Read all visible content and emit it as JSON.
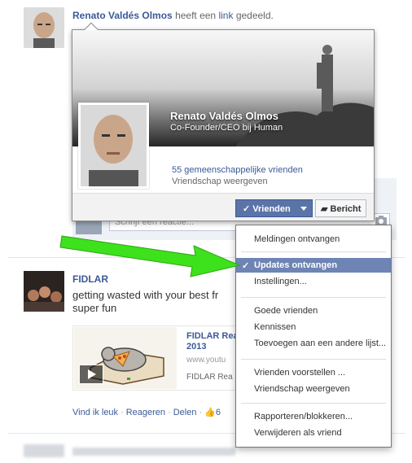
{
  "post1": {
    "author": "Renato Valdés Olmos",
    "verb": "heeft een",
    "link_word": "link",
    "verb_end": "gedeeld."
  },
  "hovercard": {
    "name": "Renato Valdés Olmos",
    "job": "Co-Founder/CEO bij Human",
    "mutual_friends": "55 gemeenschappelijke vrienden",
    "view_friendship": "Vriendschap weergeven",
    "friends_button": "Vrienden",
    "message_button": "Bericht"
  },
  "comment": {
    "placeholder": "Schrijf een reactie..."
  },
  "post2": {
    "author": "FIDLAR",
    "text": "getting wasted with your best fr... super fun",
    "text_line1": "getting wasted with your best fr",
    "text_line2": "super fun",
    "attachment": {
      "title_line1": "FIDLAR Rea",
      "title_line2": "2013",
      "url": "www.youtu",
      "desc": "FIDLAR Rea"
    },
    "actions": {
      "like": "Vind ik leuk",
      "comment": "Reageren",
      "share": "Delen",
      "like_count": "6"
    }
  },
  "menu": {
    "items": [
      {
        "label": "Meldingen ontvangen",
        "selected": false
      },
      {
        "label": "Updates ontvangen",
        "selected": true
      },
      {
        "label": "Instellingen...",
        "selected": false
      },
      {
        "label": "Goede vrienden",
        "selected": false
      },
      {
        "label": "Kennissen",
        "selected": false
      },
      {
        "label": "Toevoegen aan een andere lijst...",
        "selected": false
      },
      {
        "label": "Vrienden voorstellen ...",
        "selected": false
      },
      {
        "label": "Vriendschap weergeven",
        "selected": false
      },
      {
        "label": "Rapporteren/blokkeren...",
        "selected": false
      },
      {
        "label": "Verwijderen als vriend",
        "selected": false
      }
    ],
    "check_mark": "✓"
  },
  "colors": {
    "facebook_blue": "#3b5998",
    "selected_item": "#6d84b4",
    "annotation_arrow": "#3de11c"
  }
}
